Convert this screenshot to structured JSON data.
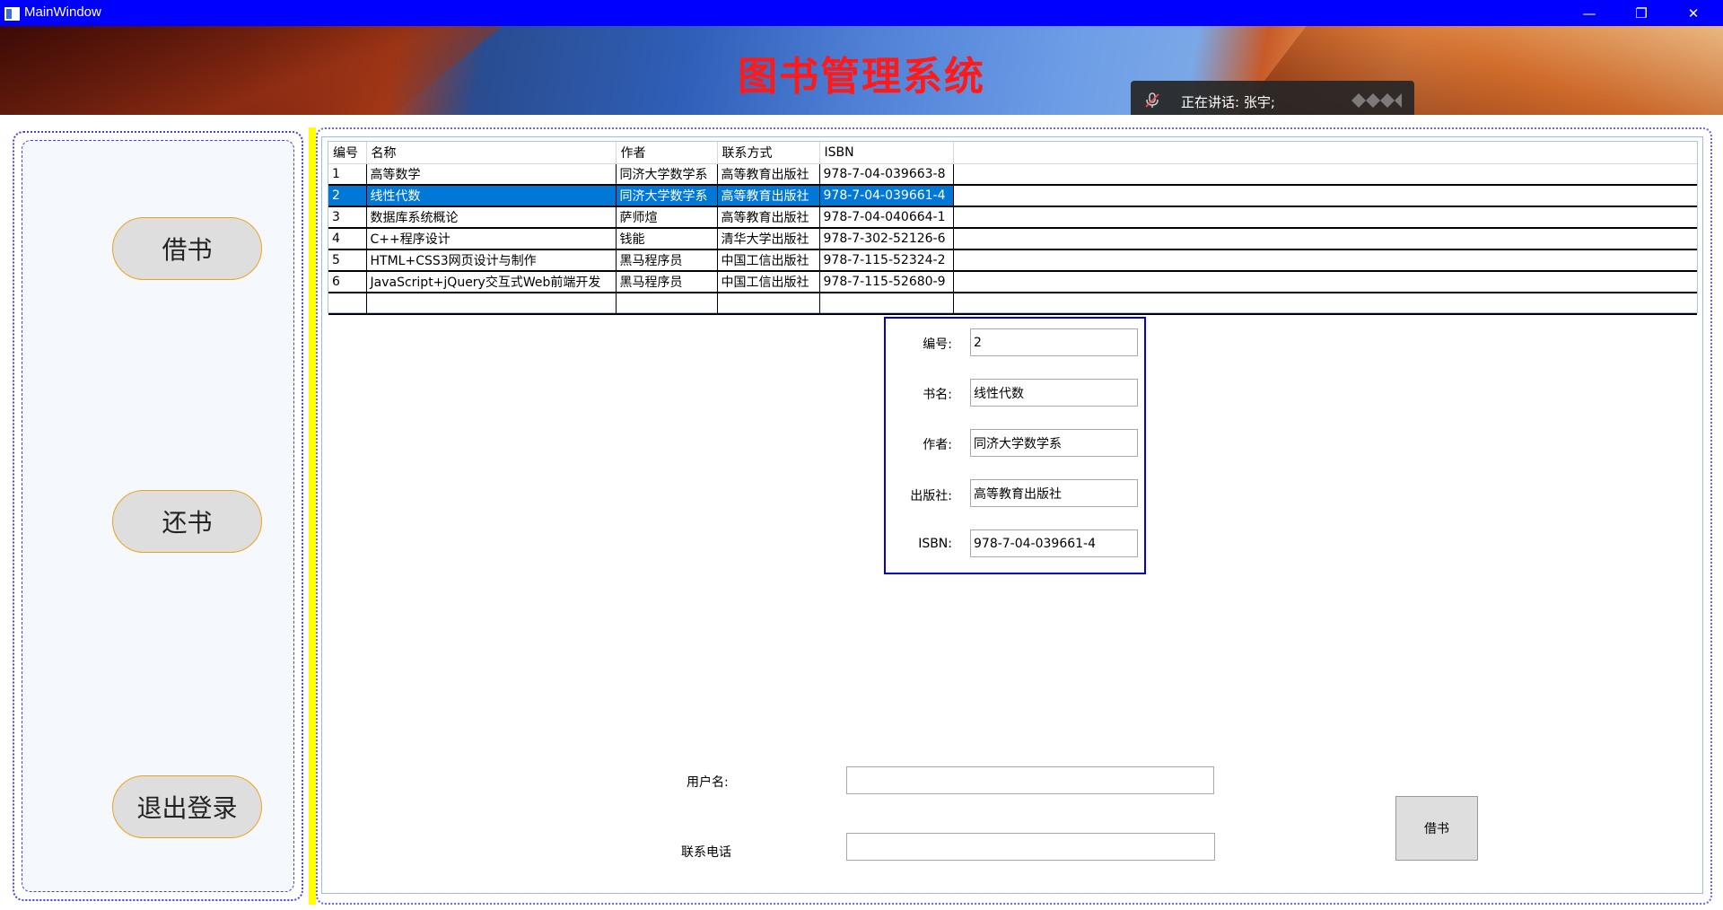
{
  "window": {
    "title": "MainWindow",
    "controls": {
      "minimize": "—",
      "restore": "❐",
      "close": "✕"
    }
  },
  "banner": {
    "system_title": "图书管理系统",
    "speaking": "正在讲话: 张宇;"
  },
  "sidebar": {
    "borrow_label": "借书",
    "return_label": "还书",
    "logout_label": "退出登录"
  },
  "grid": {
    "columns": [
      "编号",
      "名称",
      "作者",
      "联系方式",
      "ISBN"
    ],
    "rows": [
      [
        "1",
        "高等数学",
        "同济大学数学系",
        "高等教育出版社",
        "978-7-04-039663-8"
      ],
      [
        "2",
        "线性代数",
        "同济大学数学系",
        "高等教育出版社",
        "978-7-04-039661-4"
      ],
      [
        "3",
        "数据库系统概论",
        "萨师煊",
        "高等教育出版社",
        "978-7-04-040664-1"
      ],
      [
        "4",
        "C++程序设计",
        "钱能",
        "清华大学出版社",
        "978-7-302-52126-6"
      ],
      [
        "5",
        "HTML+CSS3网页设计与制作",
        "黑马程序员",
        "中国工信出版社",
        "978-7-115-52324-2"
      ],
      [
        "6",
        "JavaScript+jQuery交互式Web前端开发",
        "黑马程序员",
        "中国工信出版社",
        "978-7-115-52680-9"
      ]
    ],
    "selected_row": 2
  },
  "detail": {
    "id_label": "编号:",
    "id_value": "2",
    "name_label": "书名:",
    "name_value": "线性代数",
    "author_label": "作者:",
    "author_value": "同济大学数学系",
    "publisher_label": "出版社:",
    "publisher_value": "高等教育出版社",
    "isbn_label": "ISBN:",
    "isbn_value": "978-7-04-039661-4"
  },
  "borrow_form": {
    "username_label": "用户名:",
    "username_value": "",
    "phone_label": "联系电话",
    "phone_value": "",
    "submit_label": "借书"
  },
  "colors": {
    "title_bar": "#0000ff",
    "system_title": "#ff1a1a",
    "selection": "#0078d7",
    "panel_border": "#0000dd",
    "divider": "#ffff00",
    "button_border": "#f0a318"
  }
}
